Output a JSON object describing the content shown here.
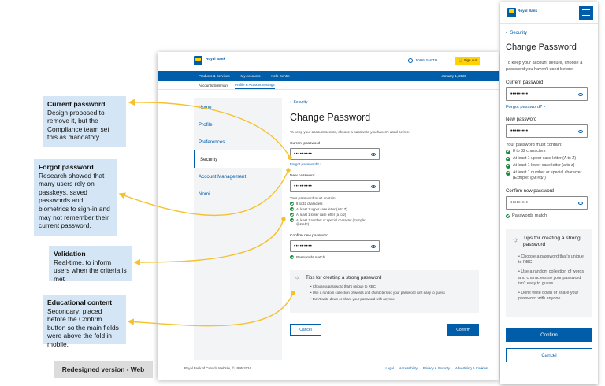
{
  "annotations": [
    {
      "title": "Current password",
      "body": "Design proposed to remove it, but the Compliance team set this as mandatory."
    },
    {
      "title": "Forgot password",
      "body": "Research showed that many users rely on passkeys, saved passwords and biometrics to sign-in and may not remember their current password."
    },
    {
      "title": "Validation",
      "body": "Real-time, to inform users when the criteria is met"
    },
    {
      "title": "Educational content",
      "body": "Secondary; placed before the Confirm button so the main fields were above the fold in mobile."
    }
  ],
  "version_label": "Redesigned version - Web",
  "web": {
    "bank_name": "Royal Bank",
    "user_name": "JOHN SMITH",
    "sign_out": "Sign out",
    "nav": [
      "Products & Services",
      "My Accounts",
      "Help Centre"
    ],
    "date": "January 1, 2023",
    "subnav": [
      "Accounts Summary",
      "Profile & Account Settings"
    ],
    "sidebar": [
      "Home",
      "Profile",
      "Preferences",
      "Security",
      "Account Management",
      "Nomi"
    ],
    "back_link": "Security",
    "page_title": "Change Password",
    "intro": "To keep your account secure, choose a password you haven't used before.",
    "current_label": "Current password",
    "password_mask": "•••••••••",
    "forgot_link": "Forgot password?",
    "new_label": "New password",
    "must_contain": "Your password must contain:",
    "criteria": [
      "8 to 32 characters",
      "At least 1 upper case letter (A to Z)",
      "At least 1 lower case letter (a to z)",
      "At least 1 number or special character (Exmple: @&%$*)"
    ],
    "confirm_label": "Confirm new password",
    "passwords_match": "Passwords match",
    "tips_title": "Tips for creating a strong password",
    "tips": [
      "Choose a password that's unique to RBC",
      "Use a random collection of words and characters so your password isn't easy to guess",
      "Don't write down or share your password with anyone"
    ],
    "cancel": "Cancel",
    "confirm": "Confirm",
    "footer_copyright": "Royal Bank of Canada Website, © 1995-2024",
    "footer_links": [
      "Legal",
      "Accessibility",
      "Privacy & Security",
      "Advertising & Cookies"
    ]
  },
  "mobile": {
    "bank_name": "Royal Bank",
    "back_link": "Security",
    "page_title": "Change Password",
    "intro": "To keep your account secure, choose a password you haven't used before.",
    "current_label": "Current password",
    "password_mask": "•••••••••",
    "forgot_link": "Forgot password?",
    "new_label": "New password",
    "must_contain": "Your password must contain:",
    "criteria": [
      "8 to 32 characters",
      "At least 1 upper case letter (A to Z)",
      "At least 1 lower case letter (a to z)",
      "At least 1 number or special character (Exmple: @&%$*)"
    ],
    "confirm_label": "Confirm new password",
    "passwords_match": "Passwords match",
    "tips_title": "Tips for creating a strong password",
    "tips": [
      "Choose a password that's unique to RBC",
      "Use a random collection of words and characters so your password isn't easy to guess",
      "Don't write down or share your password with anyone"
    ],
    "confirm": "Confirm",
    "cancel": "Cancel"
  },
  "colors": {
    "brand_blue": "#005daa",
    "brand_yellow": "#ffd200",
    "annotation_bg": "#d4e6f5",
    "arrow": "#f5c12e",
    "success": "#1a8a3b"
  }
}
